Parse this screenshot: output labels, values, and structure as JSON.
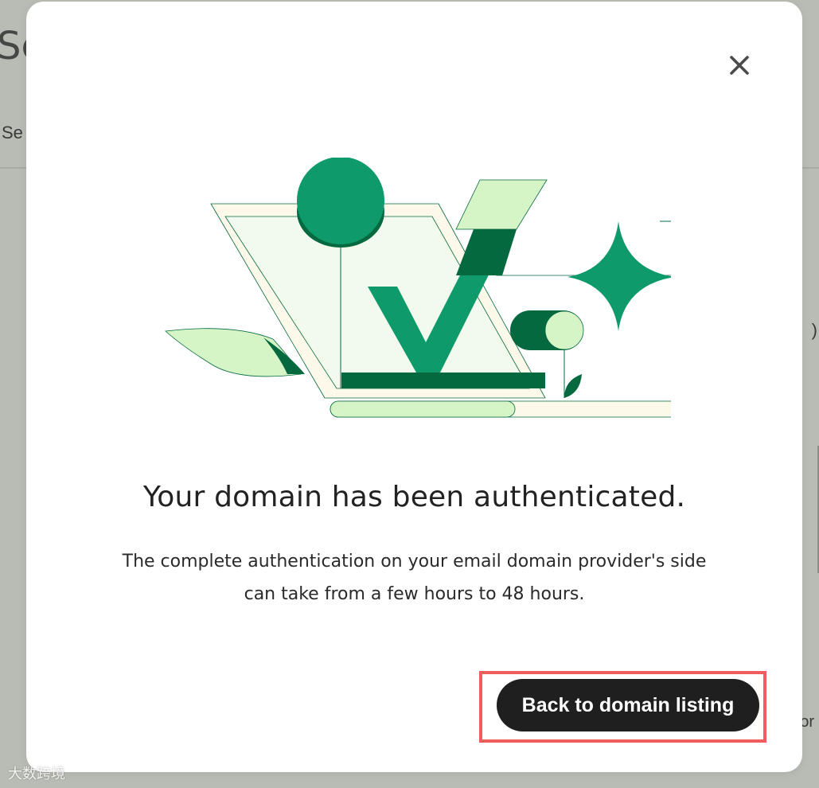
{
  "background": {
    "page_title_partial": "Se",
    "tab_partial": "Se",
    "right_text_partial": "or"
  },
  "watermark": "大数跨境",
  "modal": {
    "close_icon": "close-icon",
    "illustration": "domain-authenticated-illustration",
    "headline": "Your domain has been authenticated.",
    "body_lines": [
      "The complete authentication on your email domain provider's side",
      "can take from a few hours to 48 hours."
    ],
    "primary_button_label": "Back to domain listing"
  },
  "colors": {
    "brand_green": "#0f9a6b",
    "dark_green": "#05693f",
    "light_green": "#d5f5c7",
    "cream": "#fcf8ea",
    "button_bg": "#1f1f1f",
    "highlight": "#f25c5c",
    "overlay": "#b9bcb4"
  }
}
